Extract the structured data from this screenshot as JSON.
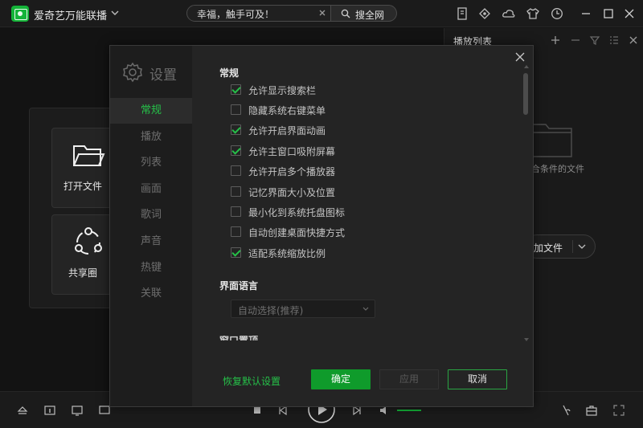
{
  "app": {
    "title": "爱奇艺万能联播",
    "search_value": "幸福，触手可及！",
    "search_button": "搜全网"
  },
  "quick_actions": [
    {
      "label": "打开文件",
      "icon": "folder-open-icon"
    },
    {
      "label": "共享圈",
      "icon": "share-circle-icon"
    }
  ],
  "playlist": {
    "title": "播放列表",
    "hint": "合条件的文件",
    "add_button": "加文件"
  },
  "settings": {
    "title": "设置",
    "nav": [
      "常规",
      "播放",
      "列表",
      "画面",
      "歌词",
      "声音",
      "热键",
      "关联"
    ],
    "active_nav": "常规",
    "general_title": "常规",
    "options": [
      {
        "label": "允许显示搜索栏",
        "checked": true
      },
      {
        "label": "隐藏系统右键菜单",
        "checked": false
      },
      {
        "label": "允许开启界面动画",
        "checked": true
      },
      {
        "label": "允许主窗口吸附屏幕",
        "checked": true
      },
      {
        "label": "允许开启多个播放器",
        "checked": false
      },
      {
        "label": "记忆界面大小及位置",
        "checked": false
      },
      {
        "label": "最小化到系统托盘图标",
        "checked": false
      },
      {
        "label": "自动创建桌面快捷方式",
        "checked": false
      },
      {
        "label": "适配系统缩放比例",
        "checked": true
      }
    ],
    "language_title": "界面语言",
    "language_value": "自动选择(推荐)",
    "next_section": "窗口置顶",
    "restore_defaults": "恢复默认设置",
    "ok": "确定",
    "apply": "应用",
    "cancel": "取消"
  },
  "colors": {
    "accent": "#26c049",
    "ok_button": "#0f9b2b",
    "background": "#141414",
    "dialog": "#242424"
  }
}
